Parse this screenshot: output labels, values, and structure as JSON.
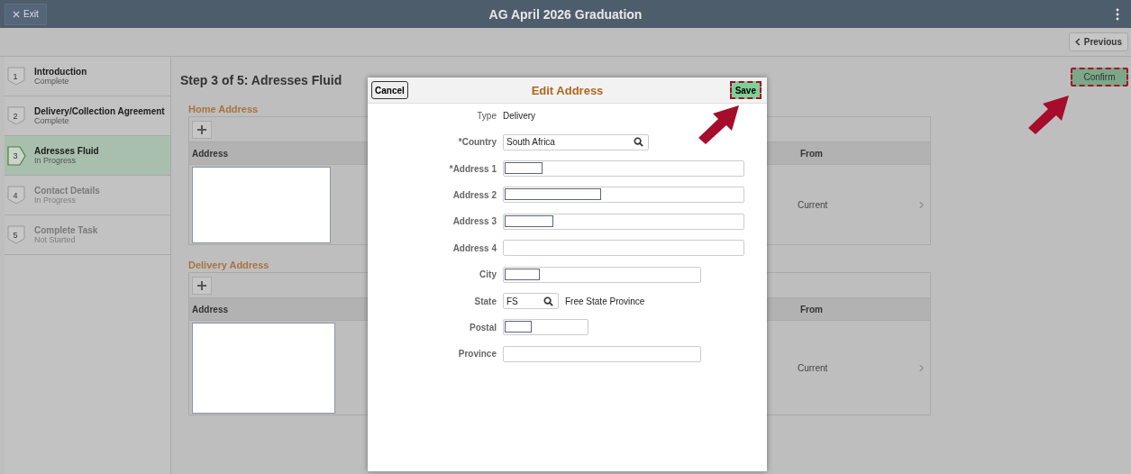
{
  "header": {
    "exit": "Exit",
    "title": "AG April 2026 Graduation"
  },
  "nav": {
    "previous": "Previous"
  },
  "steps": [
    {
      "number": "1",
      "title": "Introduction",
      "status": "Complete",
      "selected": false,
      "disabled": false
    },
    {
      "number": "2",
      "title": "Delivery/Collection Agreement",
      "status": "Complete",
      "selected": false,
      "disabled": false
    },
    {
      "number": "3",
      "title": "Adresses Fluid",
      "status": "In Progress",
      "selected": true,
      "disabled": false
    },
    {
      "number": "4",
      "title": "Contact Details",
      "status": "In Progress",
      "selected": false,
      "disabled": true
    },
    {
      "number": "5",
      "title": "Complete Task",
      "status": "Not Started",
      "selected": false,
      "disabled": true
    }
  ],
  "page_title": "Step 3 of 5: Adresses Fluid",
  "confirm": {
    "label": "Confirm",
    "highlighted": true
  },
  "sections": [
    {
      "title": "Home Address",
      "columns": [
        "Address",
        "From"
      ],
      "from": "Current"
    },
    {
      "title": "Delivery Address",
      "columns": [
        "Address",
        "From"
      ],
      "from": "Current"
    }
  ],
  "dialog": {
    "title": "Edit Address",
    "cancel": "Cancel",
    "save": {
      "label": "Save",
      "highlighted": true
    },
    "type_label": "Type",
    "type_value": "Delivery",
    "fields": [
      {
        "label": "*Country",
        "kind": "lookup",
        "value": "South Africa"
      },
      {
        "label": "*Address 1",
        "kind": "text",
        "highlight": true
      },
      {
        "label": "Address 2",
        "kind": "text",
        "highlight": true
      },
      {
        "label": "Address 3",
        "kind": "text",
        "highlight": true
      },
      {
        "label": "Address 4",
        "kind": "text",
        "highlight": false
      },
      {
        "label": "City",
        "kind": "text",
        "highlight": true
      },
      {
        "label": "State",
        "kind": "lookup",
        "value": "FS",
        "description": "Free State Province"
      },
      {
        "label": "Postal",
        "kind": "text",
        "highlight": true
      },
      {
        "label": "Province",
        "kind": "text",
        "highlight": false
      }
    ]
  }
}
